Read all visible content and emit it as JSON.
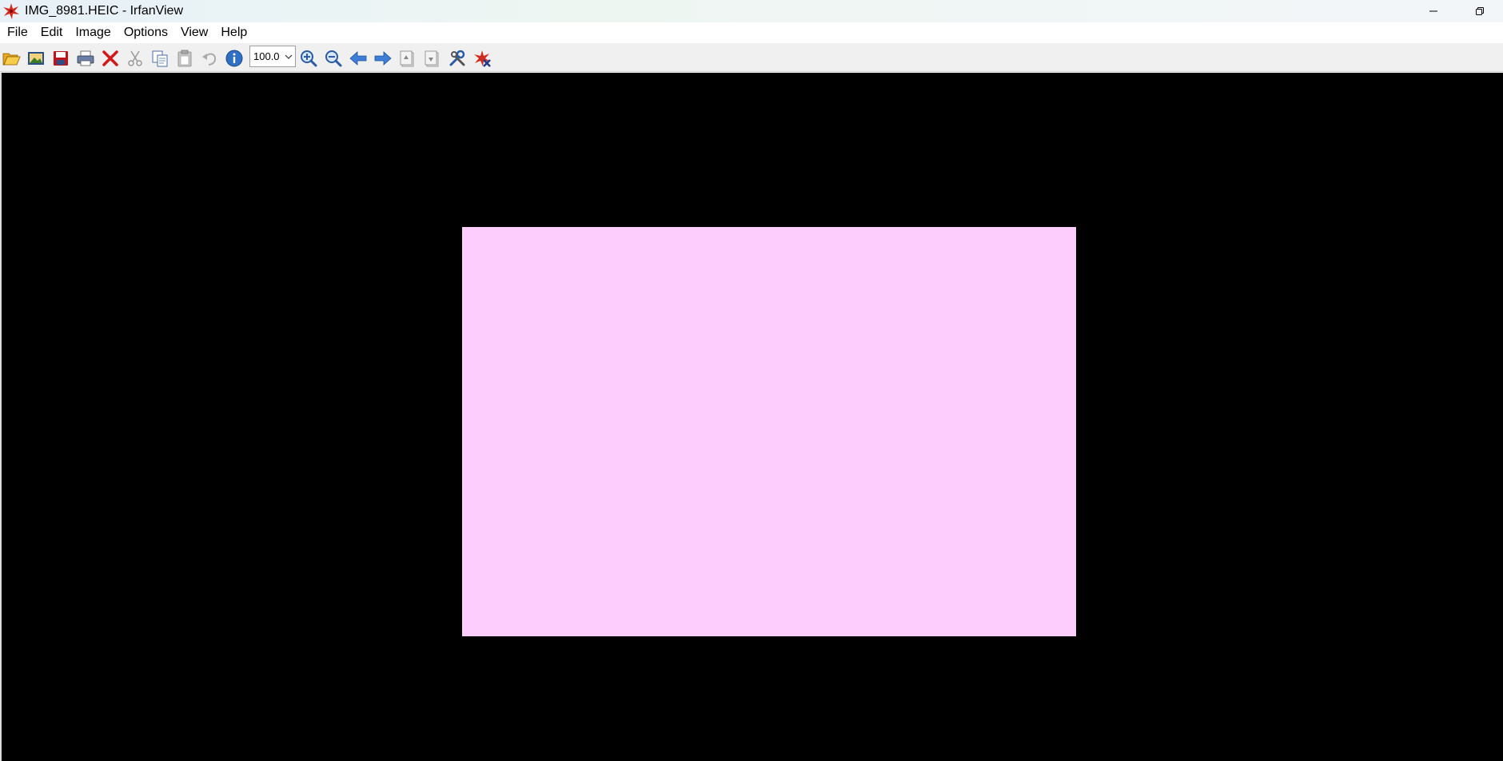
{
  "window": {
    "title": "IMG_8981.HEIC - IrfanView",
    "app_icon": "irfanview-logo-icon",
    "controls": [
      "minimize-icon",
      "restore-icon"
    ]
  },
  "menu": {
    "items": [
      "File",
      "Edit",
      "Image",
      "Options",
      "View",
      "Help"
    ]
  },
  "toolbar": {
    "buttons": [
      "open-folder-icon",
      "slideshow-icon",
      "save-icon",
      "print-icon",
      "delete-icon",
      "cut-icon",
      "copy-icon",
      "paste-icon",
      "undo-icon",
      "info-icon"
    ],
    "zoom_value": "100.0",
    "buttons_after_zoom": [
      "zoom-in-icon",
      "zoom-out-icon",
      "previous-icon",
      "next-icon",
      "first-page-icon",
      "last-page-icon",
      "settings-icon",
      "exit-icon"
    ]
  },
  "viewer": {
    "background_color": "#000000",
    "image_color": "#fdcdfd"
  }
}
